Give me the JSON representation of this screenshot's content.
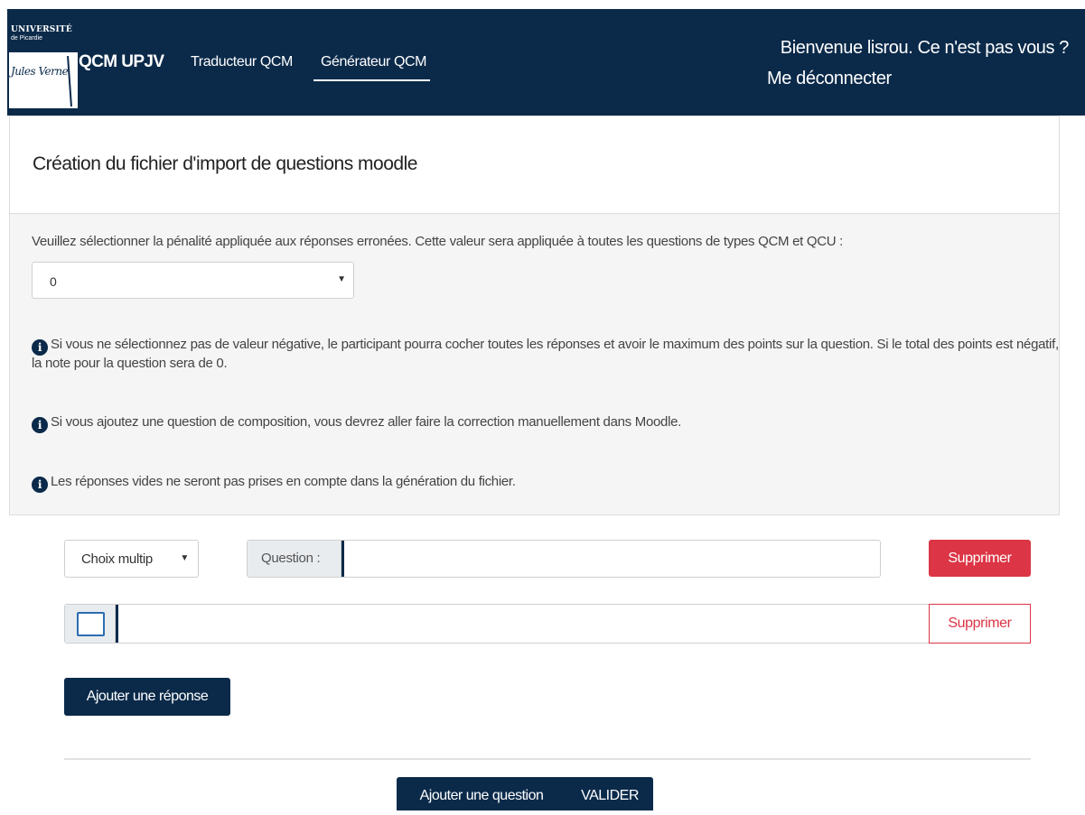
{
  "header": {
    "logo": {
      "university": "UNIVERSITÉ",
      "subtitle": "de Picardie",
      "signature": "Jules Verne"
    },
    "brand": "QCM UPJV",
    "nav": [
      {
        "label": "Traducteur QCM",
        "active": false
      },
      {
        "label": "Générateur QCM",
        "active": true
      }
    ],
    "welcome": "Bienvenue lisrou. Ce n'est pas vous ?",
    "logout": "Me déconnecter"
  },
  "panel": {
    "title": "Création du fichier d'import de questions moodle",
    "penalty_label": "Veuillez sélectionner la pénalité appliquée aux réponses erronées. Cette valeur sera appliquée à toutes les questions de types QCM et QCU :",
    "penalty_value": "0",
    "info": [
      "Si vous ne sélectionnez pas de valeur négative, le participant pourra cocher toutes les réponses et avoir le maximum des points sur la question. Si le total des points est négatif, la note pour la question sera de 0.",
      "Si vous ajoutez une question de composition, vous devrez aller faire la correction manuellement dans Moodle.",
      "Les réponses vides ne seront pas prises en compte dans la génération du fichier."
    ]
  },
  "question": {
    "type_value": "Choix multip",
    "label": "Question :",
    "value": "",
    "delete_label": "Supprimer"
  },
  "answer": {
    "value": "",
    "checked": false,
    "delete_label": "Supprimer"
  },
  "actions": {
    "add_answer": "Ajouter une réponse",
    "add_question": "Ajouter une question",
    "validate": "VALIDER"
  },
  "colors": {
    "navy": "#0b2a4a",
    "danger": "#dc3545",
    "panel_bg": "#f5f5f5"
  },
  "icons": [
    "info-icon",
    "chevron-down-icon",
    "checkbox-icon"
  ]
}
